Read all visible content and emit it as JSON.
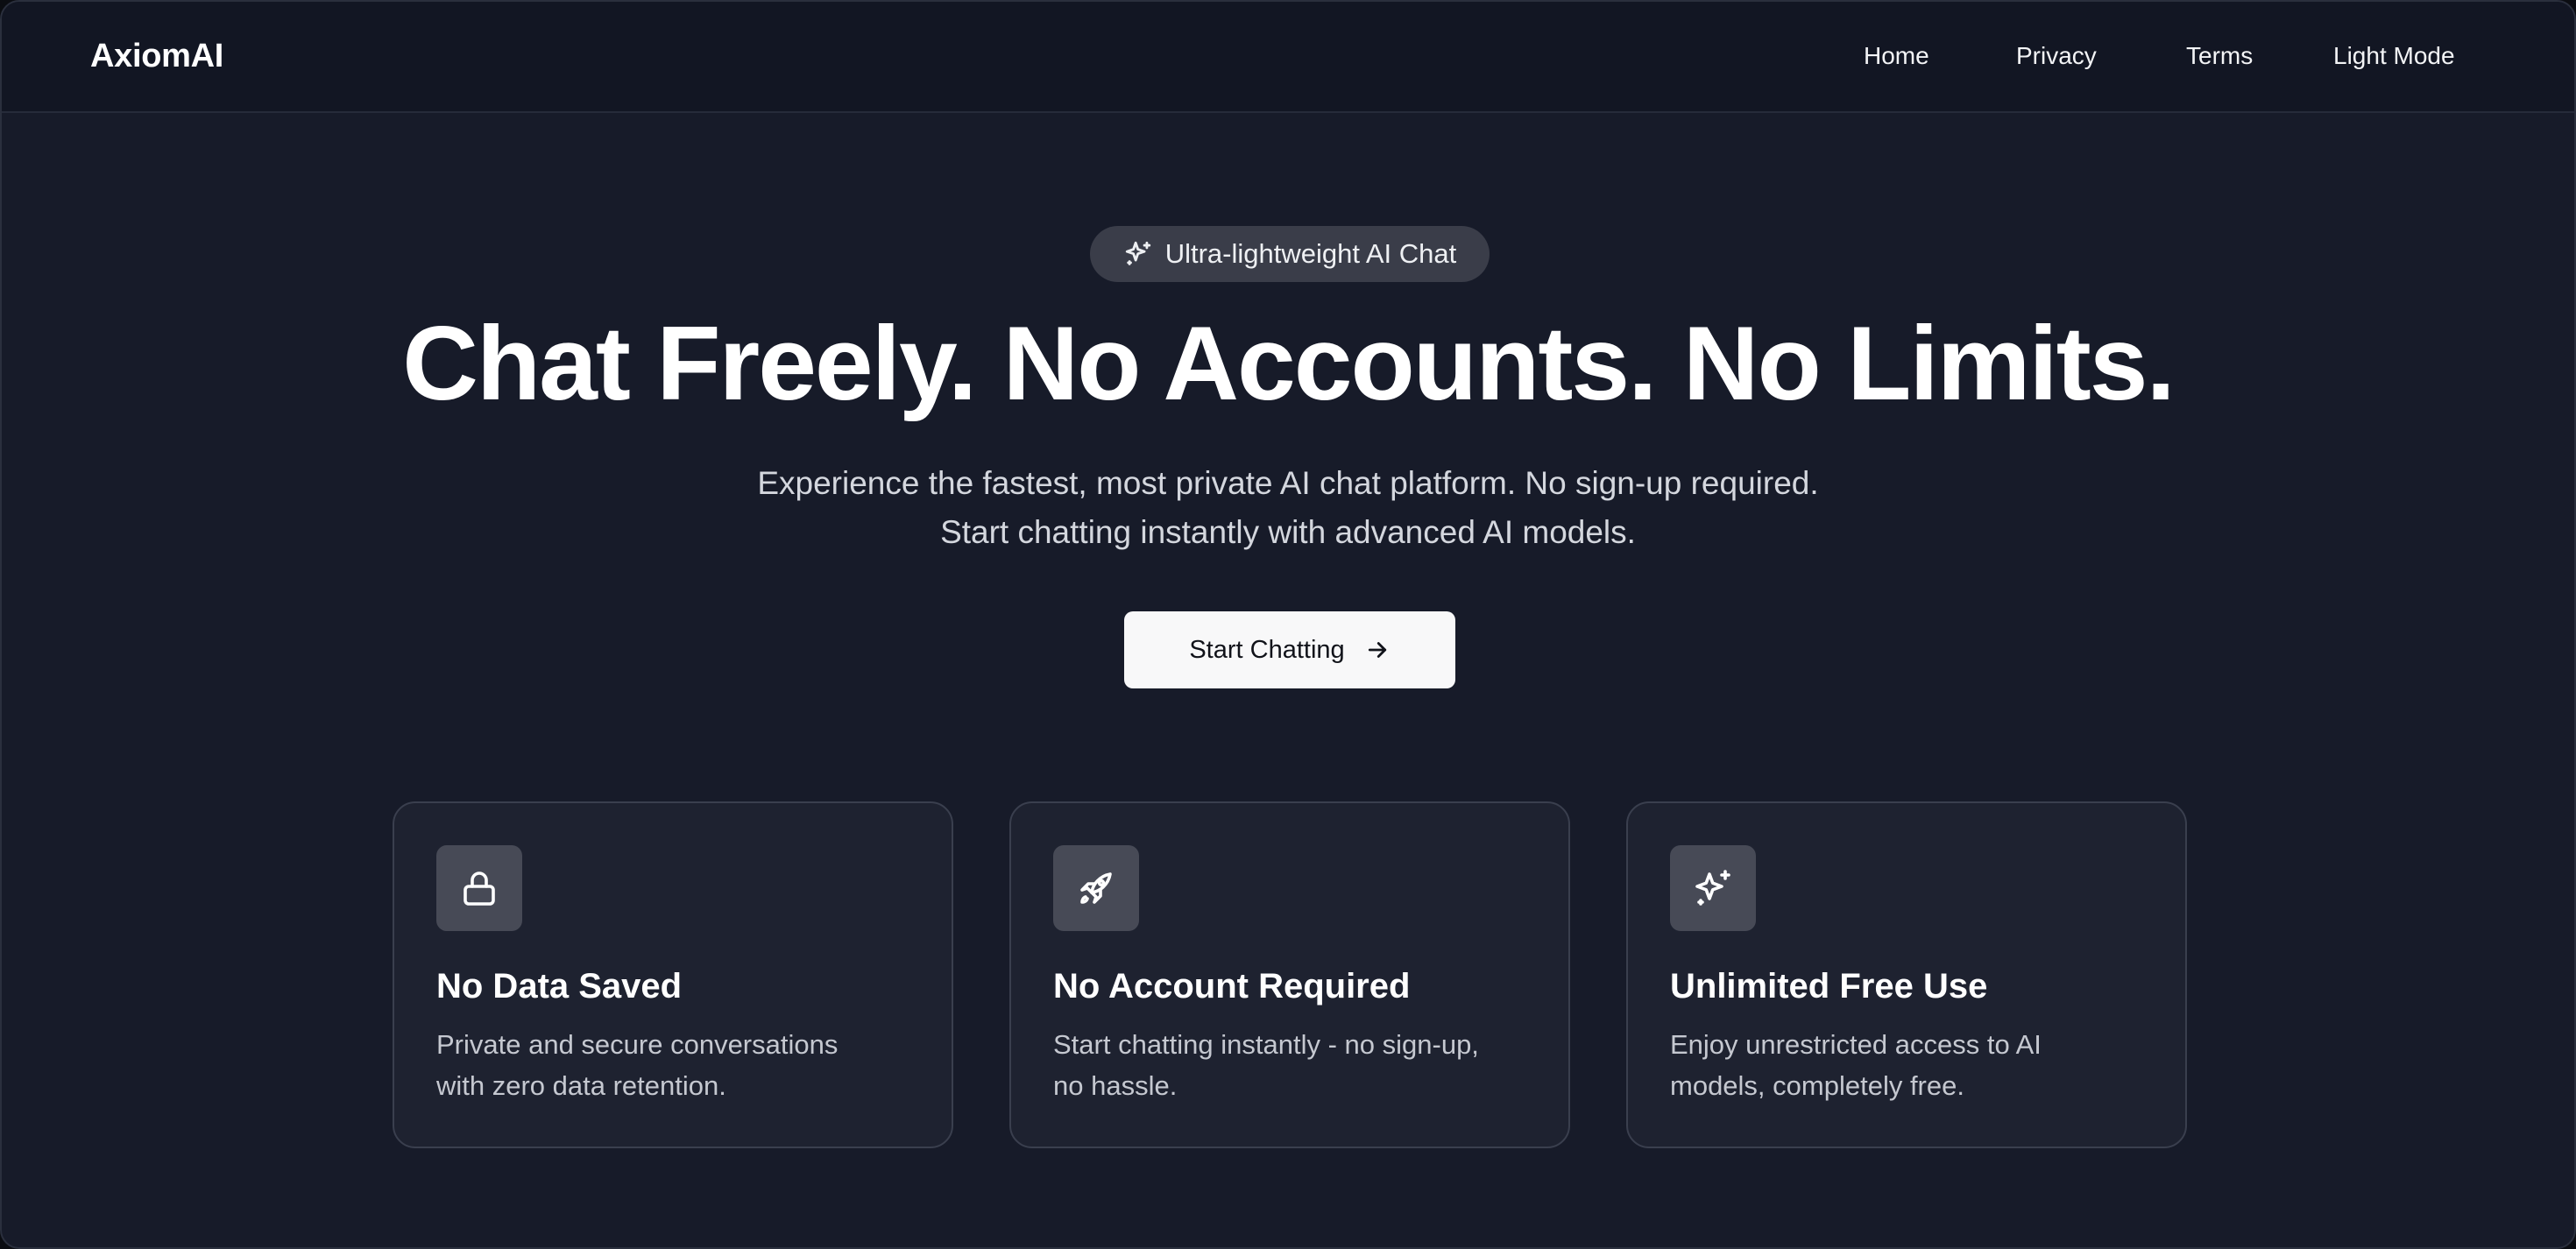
{
  "header": {
    "brand": "AxiomAI",
    "nav": [
      {
        "label": "Home"
      },
      {
        "label": "Privacy"
      },
      {
        "label": "Terms"
      },
      {
        "label": "Light Mode"
      }
    ]
  },
  "hero": {
    "badge_icon": "sparkles-icon",
    "badge_text": "Ultra-lightweight AI Chat",
    "title": "Chat Freely. No Accounts. No Limits.",
    "subtitle_line1": "Experience the fastest, most private AI chat platform. No sign-up required.",
    "subtitle_line2": "Start chatting instantly with advanced AI models.",
    "cta_label": "Start Chatting",
    "cta_icon": "arrow-right-icon"
  },
  "features": [
    {
      "icon": "lock-icon",
      "title": "No Data Saved",
      "description": "Private and secure conversations with zero data retention."
    },
    {
      "icon": "rocket-icon",
      "title": "No Account Required",
      "description": "Start chatting instantly - no sign-up, no hassle."
    },
    {
      "icon": "sparkles-icon",
      "title": "Unlimited Free Use",
      "description": "Enjoy unrestricted access to AI models, completely free."
    }
  ],
  "colors": {
    "background": "#171b29",
    "header_background": "#121623",
    "card_background": "#1e2230",
    "card_border": "#3a3f4e",
    "badge_background": "#3a3d49",
    "cta_background": "#f8f8f9"
  }
}
